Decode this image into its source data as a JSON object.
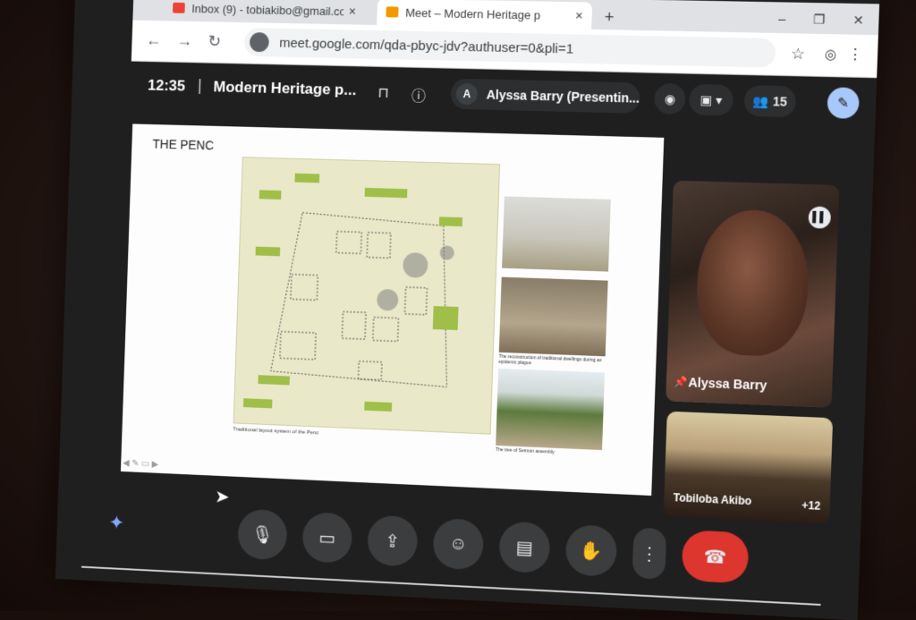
{
  "browser": {
    "tabs": [
      {
        "label": "Inbox (9) - tobiakibo@gmail.co",
        "close": "×",
        "favicon": "gmail-icon",
        "active": false
      },
      {
        "label": "Meet – Modern Heritage p",
        "close": "×",
        "favicon": "meet-icon",
        "active": true
      }
    ],
    "new_tab": "+",
    "url": "meet.google.com/qda-pbyc-jdv?authuser=0&pli=1",
    "window_controls": [
      "–",
      "❐",
      "✕"
    ]
  },
  "meet": {
    "time": "12:35",
    "separator": "|",
    "title": "Modern Heritage p...",
    "presenter": {
      "initial": "A",
      "label": "Alyssa Barry (Presentin..."
    },
    "participant_count": "15"
  },
  "slide": {
    "title": "THE PENC",
    "plan_caption": "Traditional layout system of the Penc",
    "photo_captions": [
      "",
      "The reconstruction of traditional dwellings during an epidemic plague",
      "The tree of Sermon assembly"
    ]
  },
  "participants": [
    {
      "name": "Alyssa Barry"
    },
    {
      "name": "Tobiloba Akibo",
      "extra": "+12"
    }
  ],
  "colors": {
    "accent": "#a8c7fa",
    "hangup": "#dc362e",
    "label_green": "#9fbf49"
  }
}
